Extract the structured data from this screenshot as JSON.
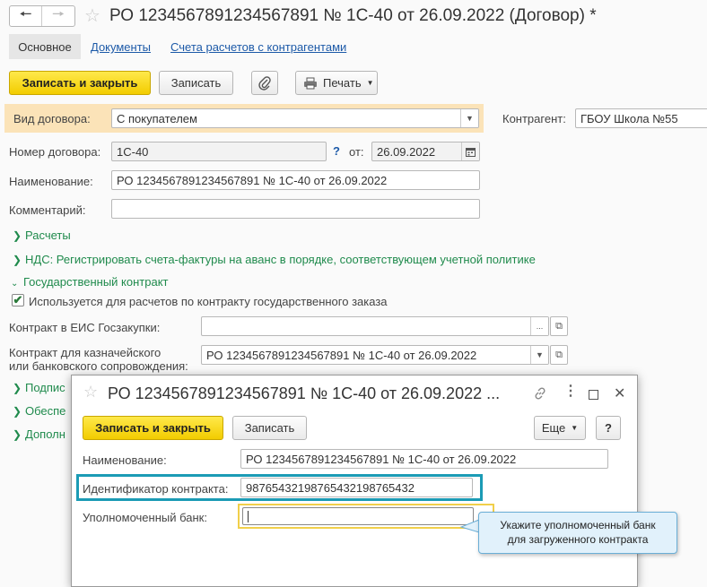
{
  "window": {
    "title": "РО 1234567891234567891 № 1С-40 от 26.09.2022 (Договор) *"
  },
  "tabs": {
    "main": "Основное",
    "documents": "Документы",
    "accounts": "Счета расчетов с контрагентами"
  },
  "toolbar": {
    "save_close": "Записать и закрыть",
    "save": "Записать",
    "print": "Печать"
  },
  "form": {
    "contract_type_label": "Вид договора:",
    "contract_type_value": "С покупателем",
    "counterparty_label": "Контрагент:",
    "counterparty_value": "ГБОУ Школа №55",
    "number_label": "Номер договора:",
    "number_value": "1С-40",
    "help_mark": "?",
    "date_label": "от:",
    "date_value": "26.09.2022",
    "name_label": "Наименование:",
    "name_value": "РО 1234567891234567891 № 1С-40 от 26.09.2022",
    "comment_label": "Комментарий:",
    "comment_value": ""
  },
  "sections": {
    "payments": "Расчеты",
    "vat": "НДС: Регистрировать счета-фактуры на аванс в порядке, соответствующем учетной политике",
    "gov_contract": "Государственный контракт",
    "gov_checkbox_label": "Используется для расчетов по контракту государственного заказа",
    "eis_label": "Контракт в ЕИС Госзакупки:",
    "eis_value": "",
    "treasury_label_line1": "Контракт для казначейского",
    "treasury_label_line2": "или банковского сопровождения:",
    "treasury_value": "РО 1234567891234567891 № 1С-40 от 26.09.2022",
    "truncated_1": "Подпис",
    "truncated_2": "Обеспе",
    "truncated_3": "Дополн"
  },
  "dialog": {
    "title": "РО 1234567891234567891 № 1С-40 от 26.09.2022 ...",
    "save_close": "Записать и закрыть",
    "save": "Записать",
    "more": "Еще",
    "help": "?",
    "name_label": "Наименование:",
    "name_value": "РО 1234567891234567891 № 1С-40 от 26.09.2022",
    "contract_id_label": "Идентификатор контракта:",
    "contract_id_value": "98765432198765432198765432",
    "bank_label": "Уполномоченный банк:",
    "bank_value": ""
  },
  "tooltip": {
    "line1": "Укажите уполномоченный банк",
    "line2": "для загруженного контракта"
  },
  "colors": {
    "accent_yellow": "#f6d600",
    "highlight_row": "#fbe3b8",
    "section_green": "#1f8a4c",
    "link_blue": "#1d5aa8",
    "annotation_teal": "#1b9bb5"
  }
}
